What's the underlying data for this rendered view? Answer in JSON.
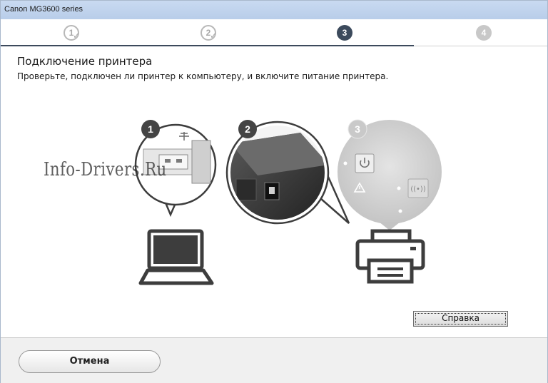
{
  "window": {
    "title": "Canon MG3600 series"
  },
  "steps": [
    {
      "number": "1",
      "state": "done"
    },
    {
      "number": "2",
      "state": "done"
    },
    {
      "number": "3",
      "state": "active"
    },
    {
      "number": "4",
      "state": "future"
    }
  ],
  "step_check_glyph": "✓",
  "page": {
    "heading": "Подключение принтера",
    "description": "Проверьте, подключен ли принтер к компьютеру, и включите питание принтера."
  },
  "illustration": {
    "badges": [
      "1",
      "2",
      "3"
    ],
    "icons": [
      "usb-icon",
      "printer-rear-port-icon",
      "power-icon",
      "warning-icon",
      "wireless-icon",
      "laptop-icon",
      "printer-icon"
    ]
  },
  "watermark": "Info-Drivers.Ru",
  "buttons": {
    "help": "Справка",
    "cancel": "Отмена"
  },
  "colors": {
    "active_step": "#3c4a5c",
    "future_step": "#c8c8c8",
    "titlebar": "#c9daf1",
    "icon_dark": "#3d3d3d"
  }
}
